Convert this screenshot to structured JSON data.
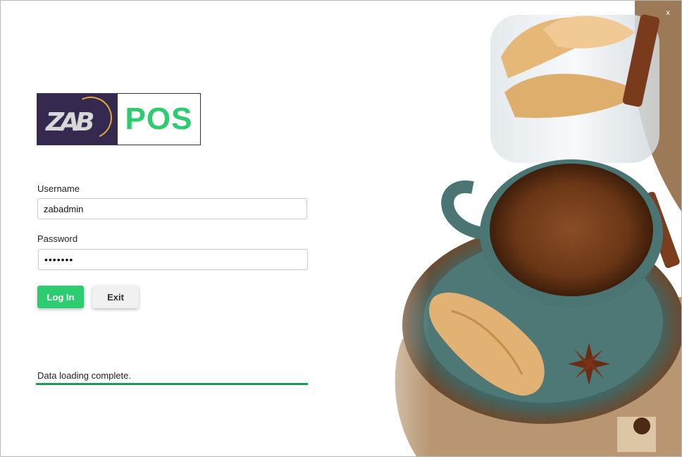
{
  "window": {
    "close_label": "x"
  },
  "logo": {
    "mark_text": "ZAB",
    "product_text": "POS"
  },
  "form": {
    "username_label": "Username",
    "username_value": "zabadmin",
    "password_label": "Password",
    "password_value": "•••••••"
  },
  "buttons": {
    "login_label": "Log In",
    "exit_label": "Exit"
  },
  "status": {
    "text": "Data loading complete.",
    "progress_fraction": 1.0
  },
  "colors": {
    "accent": "#2ecc71",
    "progress": "#1e9c55",
    "logo_bg": "#35294f"
  },
  "photo": {
    "name": "coffee-croissant-photo"
  }
}
